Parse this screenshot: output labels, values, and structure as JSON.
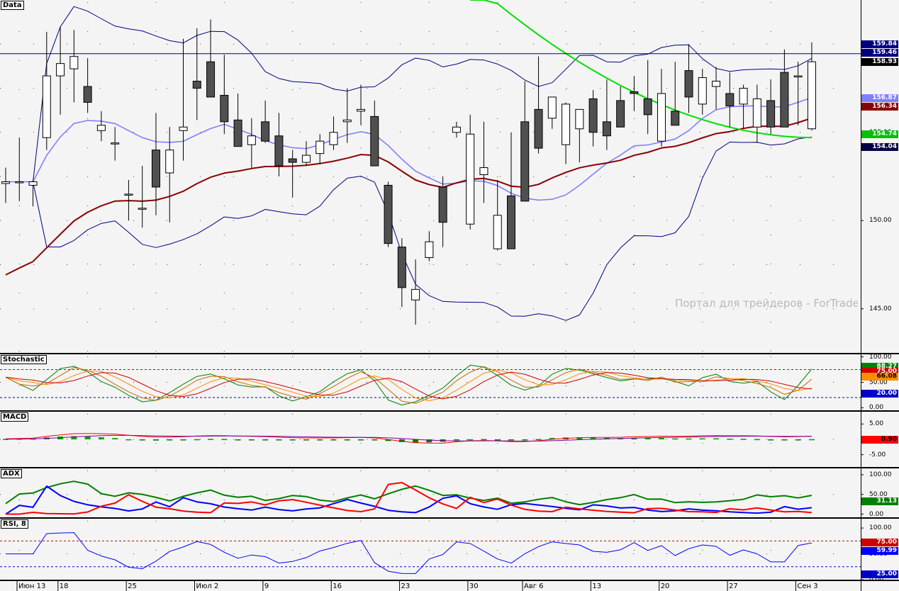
{
  "watermark": "Портал для трейдеров - ForTrader",
  "panels": {
    "price": "Data",
    "stochastic": "Stochastic",
    "macd": "MACD",
    "adx": "ADX",
    "rsi": "RSI, 8"
  },
  "price_axis": [
    "145.00",
    "150.00",
    "155.00",
    "160.00"
  ],
  "stoch_axis": [
    "100.00",
    "50.00",
    "0.00"
  ],
  "macd_axis": [
    "5.00",
    "-5.00"
  ],
  "adx_axis": [
    "100.00",
    "50.00",
    "0.00"
  ],
  "rsi_axis": [
    "100.00",
    "50.00",
    "0.00"
  ],
  "price_tags": [
    {
      "text": "159.84",
      "bg": "#000080",
      "fg": "#ffffff"
    },
    {
      "text": "159.46",
      "bg": "#000080",
      "fg": "#ffffff"
    },
    {
      "text": "158.93",
      "bg": "#000000",
      "fg": "#ffffff"
    },
    {
      "text": "156.87",
      "bg": "#8080ff",
      "fg": "#ffffff"
    },
    {
      "text": "156.34",
      "bg": "#8b0000",
      "fg": "#ffffff"
    },
    {
      "text": "154.74",
      "bg": "#00c000",
      "fg": "#ffffff"
    },
    {
      "text": "154.04",
      "bg": "#000040",
      "fg": "#ffffff"
    }
  ],
  "stoch_tags": [
    {
      "text": "88.27",
      "bg": "#008000",
      "fg": "#ffffff"
    },
    {
      "text": "75.00",
      "bg": "#cc0000",
      "fg": "#ffffff"
    },
    {
      "text": "66.08",
      "bg": "#ff8c00",
      "fg": "#000000"
    },
    {
      "text": "20.00",
      "bg": "#0000cc",
      "fg": "#ffffff"
    }
  ],
  "macd_tags": [
    {
      "text": "0.90",
      "bg": "#ff0000",
      "fg": "#000000"
    }
  ],
  "adx_tags": [
    {
      "text": "31.13",
      "bg": "#008000",
      "fg": "#ffffff"
    }
  ],
  "rsi_tags": [
    {
      "text": "75.00",
      "bg": "#cc0000",
      "fg": "#ffffff"
    },
    {
      "text": "59.99",
      "bg": "#0000ff",
      "fg": "#ffffff"
    },
    {
      "text": "25.00",
      "bg": "#0000cc",
      "fg": "#ffffff"
    }
  ],
  "x_labels": [
    "Июн 13",
    "18",
    "25",
    "Июл 2",
    "9",
    "16",
    "23",
    "30",
    "Авг 6",
    "13",
    "20",
    "27",
    "Сен 3"
  ],
  "chart_data": {
    "type": "candlestick",
    "title": "Data",
    "ylim": [
      142.5,
      162.5
    ],
    "dates": [
      "Июн 13",
      "Июн 14",
      "Июн 15",
      "Июн 18",
      "Июн 19",
      "Июн 20",
      "Июн 21",
      "Июн 22",
      "Июн 25",
      "Июн 26",
      "Июн 27",
      "Июн 28",
      "Июн 29",
      "Июл 2",
      "Июл 3",
      "Июл 5",
      "Июл 6",
      "Июл 9",
      "Июл 10",
      "Июл 11",
      "Июл 12",
      "Июл 13",
      "Июл 16",
      "Июл 17",
      "Июл 18",
      "Июл 19",
      "Июл 20",
      "Июл 23",
      "Июл 24",
      "Июл 25",
      "Июл 26",
      "Июл 27",
      "Июл 30",
      "Июл 31",
      "Авг 1",
      "Авг 2",
      "Авг 3",
      "Авг 6",
      "Авг 7",
      "Авг 8",
      "Авг 9",
      "Авг 10",
      "Авг 13",
      "Авг 14",
      "Авг 15",
      "Авг 16",
      "Авг 17",
      "Авг 20",
      "Авг 21",
      "Авг 22",
      "Авг 23",
      "Авг 24",
      "Авг 27",
      "Авг 28",
      "Авг 29",
      "Авг 30",
      "Авг 31",
      "Сен 4",
      "Сен 5",
      "Сен 6"
    ],
    "open": [
      152.1,
      152.2,
      152.0,
      154.7,
      158.2,
      158.6,
      157.6,
      155.1,
      154.4,
      151.5,
      150.7,
      154.0,
      152.7,
      155.1,
      157.9,
      159.0,
      157.1,
      155.7,
      154.3,
      155.6,
      154.8,
      153.5,
      153.3,
      153.8,
      154.3,
      155.6,
      156.2,
      155.9,
      152.0,
      148.5,
      145.5,
      147.9,
      151.9,
      155.0,
      149.8,
      152.6,
      148.4,
      151.4,
      155.6,
      156.3,
      155.8,
      154.3,
      155.2,
      156.9,
      155.6,
      156.8,
      157.3,
      156.9,
      154.5,
      156.2,
      158.5,
      156.6,
      157.6,
      157.2,
      156.6,
      155.3,
      156.8,
      158.4,
      158.2,
      155.2
    ],
    "high": [
      153.0,
      154.7,
      152.3,
      160.7,
      161.0,
      160.8,
      159.2,
      156.2,
      155.3,
      152.3,
      153.1,
      156.1,
      155.3,
      160.3,
      160.9,
      161.4,
      159.4,
      157.2,
      155.8,
      156.8,
      156.1,
      154.0,
      154.5,
      154.9,
      155.9,
      157.5,
      157.7,
      156.8,
      152.2,
      149.0,
      147.8,
      149.4,
      152.5,
      155.6,
      156.0,
      155.6,
      152.3,
      155.0,
      157.9,
      159.3,
      157.0,
      156.7,
      155.5,
      157.4,
      158.0,
      157.6,
      158.2,
      159.1,
      158.6,
      159.0,
      160.0,
      158.6,
      158.7,
      158.4,
      157.7,
      157.7,
      158.0,
      159.7,
      159.0,
      160.1
    ],
    "low": [
      151.0,
      151.1,
      150.8,
      154.0,
      156.0,
      156.7,
      156.1,
      154.5,
      153.4,
      150.0,
      149.6,
      150.3,
      149.9,
      153.4,
      155.7,
      158.6,
      154.9,
      154.2,
      153.0,
      154.4,
      152.5,
      151.3,
      153.1,
      153.2,
      154.0,
      154.4,
      155.4,
      154.8,
      148.5,
      145.1,
      144.1,
      147.7,
      148.5,
      154.7,
      149.5,
      151.0,
      148.3,
      148.5,
      151.7,
      153.8,
      155.2,
      153.2,
      153.3,
      154.2,
      154.0,
      156.0,
      156.2,
      154.9,
      154.2,
      155.8,
      156.1,
      156.0,
      156.3,
      155.3,
      155.2,
      154.4,
      154.9,
      155.7,
      155.4,
      155.1
    ],
    "close": [
      152.2,
      152.2,
      152.2,
      158.2,
      158.9,
      159.3,
      156.7,
      155.4,
      154.4,
      151.5,
      150.7,
      151.9,
      154.0,
      155.3,
      157.5,
      157.0,
      155.6,
      154.2,
      154.8,
      154.5,
      153.1,
      153.3,
      153.7,
      154.5,
      155.0,
      155.7,
      156.3,
      153.1,
      148.7,
      146.2,
      146.1,
      148.8,
      149.9,
      155.3,
      154.9,
      153.0,
      150.3,
      148.4,
      151.1,
      154.1,
      157.0,
      156.6,
      156.3,
      155.0,
      154.8,
      155.3,
      157.2,
      156.0,
      157.2,
      155.4,
      157.0,
      158.1,
      157.9,
      156.5,
      157.5,
      156.9,
      155.3,
      155.3,
      158.2,
      159.0
    ],
    "overlays": [
      {
        "name": "Bollinger upper",
        "color": "#000080"
      },
      {
        "name": "Bollinger middle",
        "color": "#8080ff"
      },
      {
        "name": "Bollinger lower",
        "color": "#000080"
      },
      {
        "name": "MA slow",
        "color": "#8b0000"
      },
      {
        "name": "MA long",
        "color": "#00e000"
      }
    ],
    "last_values": {
      "upper": 159.84,
      "middle": 156.87,
      "lower": 154.04,
      "ma_slow": 156.34,
      "ma_long": 154.74,
      "close": 158.93,
      "hline": 159.46
    },
    "indicators": {
      "stochastic": {
        "levels": [
          75,
          20
        ],
        "last": [
          88.27,
          66.08
        ]
      },
      "macd": {
        "last": 0.9
      },
      "adx": {
        "last": 31.13
      },
      "rsi": {
        "period": 8,
        "levels": [
          75,
          25
        ],
        "last": 59.99
      }
    }
  }
}
